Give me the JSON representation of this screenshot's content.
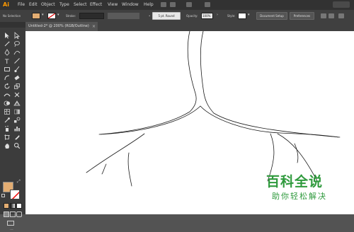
{
  "app": {
    "logo": "Ai"
  },
  "menu": [
    "File",
    "Edit",
    "Object",
    "Type",
    "Select",
    "Effect",
    "View",
    "Window",
    "Help"
  ],
  "control_bar": {
    "selection_label": "No Selection",
    "fill_color": "#e3ad72",
    "stroke_label": "Stroke:",
    "brush_value": "5 pt. Round",
    "opacity_label": "Opacity:",
    "opacity_value": "100%",
    "style_label": "Style:",
    "document_setup": "Document Setup",
    "preferences": "Preferences"
  },
  "document_tab": {
    "title": "Untitled-2* @ 200% (RGB/Outline)",
    "close": "×"
  },
  "swatches": {
    "fill": "#e3ad72",
    "stroke": "#ffffff"
  },
  "watermark": {
    "line1": "百科全说",
    "line2": "助你轻松解决",
    "color": "#2f9a3d"
  }
}
